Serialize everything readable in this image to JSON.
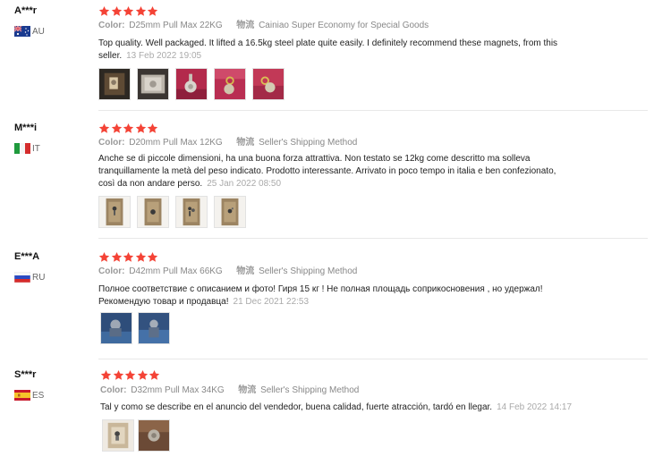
{
  "reviews": [
    {
      "buyer": "A***r",
      "country_code": "AU",
      "color_label": "Color:",
      "color_value": "D25mm Pull Max 22KG",
      "shipping_label": "物流",
      "shipping_value": "Cainiao Super Economy for Special Goods",
      "text_lines": [
        "Top quality. Well packaged. It lifted a 16.5kg steel plate quite easily. I definitely recommend these magnets, from this",
        "seller."
      ],
      "date": "13 Feb 2022 19:05",
      "stars": 5,
      "photo_count": 5
    },
    {
      "buyer": "M***i",
      "country_code": "IT",
      "color_label": "Color:",
      "color_value": "D20mm Pull Max 12KG",
      "shipping_label": "物流",
      "shipping_value": "Seller's Shipping Method",
      "text_lines": [
        "Anche se di piccole dimensioni, ha una buona forza attrattiva. Non testato se 12kg come descritto ma solleva",
        "tranquillamente la metà del peso indicato. Prodotto interessante. Arrivato in poco tempo in italia e ben confezionato,",
        "così da non andare perso."
      ],
      "date": "25 Jan 2022 08:50",
      "stars": 5,
      "photo_count": 4
    },
    {
      "buyer": "E***A",
      "country_code": "RU",
      "color_label": "Color:",
      "color_value": "D42mm Pull Max 66KG",
      "shipping_label": "物流",
      "shipping_value": "Seller's Shipping Method",
      "text_lines": [
        "Полное соответствие с описанием и фото! Гиря 15 кг ! Не полная площадь соприкосновения , но удержал!",
        "Рекомендую товар и продавца!"
      ],
      "date": "21 Dec 2021 22:53",
      "stars": 5,
      "photo_count": 2
    },
    {
      "buyer": "S***r",
      "country_code": "ES",
      "color_label": "Color:",
      "color_value": "D32mm Pull Max 34KG",
      "shipping_label": "物流",
      "shipping_value": "Seller's Shipping Method",
      "text_lines": [
        "Tal y como se describe en el anuncio del vendedor, buena calidad, fuerte atracción, tardó en llegar."
      ],
      "date": "14 Feb 2022 14:17",
      "stars": 5,
      "photo_count": 2
    }
  ],
  "colors": {
    "star": "#f44336",
    "muted_text": "#999999",
    "body_text": "#222222",
    "divider": "#e8e8e8"
  },
  "icons": {
    "star": "star-icon",
    "flag_au": "flag-au-icon",
    "flag_it": "flag-it-icon",
    "flag_ru": "flag-ru-icon",
    "flag_es": "flag-es-icon",
    "photo": "review-photo"
  }
}
